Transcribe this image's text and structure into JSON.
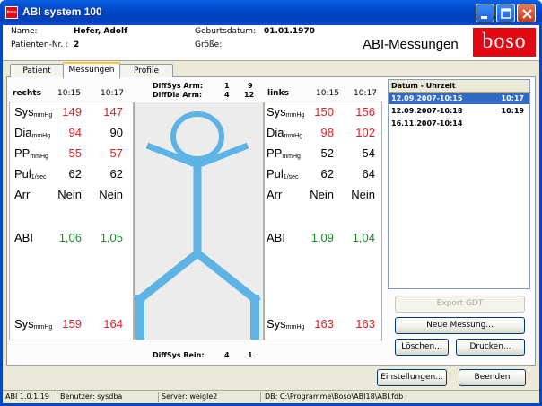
{
  "window": {
    "title": "ABI system 100",
    "app_icon": "boso-app-icon"
  },
  "header": {
    "name_label": "Name:",
    "name_value": "Hofer, Adolf",
    "patient_nr_label": "Patienten-Nr. :",
    "patient_nr_value": "2",
    "birth_label": "Geburtsdatum:",
    "birth_value": "01.01.1970",
    "size_label": "Größe:",
    "size_value": "",
    "section_title": "ABI-Messungen",
    "logo_text": "boso"
  },
  "tabs": [
    {
      "label": "Patient",
      "active": false
    },
    {
      "label": "Messungen",
      "active": true
    },
    {
      "label": "Profile",
      "active": false
    }
  ],
  "diff": {
    "sys_arm_label": "DiffSys Arm:",
    "sys_arm_a": "1",
    "sys_arm_b": "9",
    "dia_arm_label": "DiffDia Arm:",
    "dia_arm_a": "4",
    "dia_arm_b": "12",
    "sys_bein_label": "DiffSys Bein:",
    "sys_bein_a": "4",
    "sys_bein_b": "1"
  },
  "left": {
    "side": "rechts",
    "time1": "10:15",
    "time2": "10:17",
    "sys": [
      "149",
      "147"
    ],
    "dia": [
      "94",
      "90"
    ],
    "pp": [
      "55",
      "57"
    ],
    "pul": [
      "62",
      "62"
    ],
    "arr": [
      "Nein",
      "Nein"
    ],
    "abi": [
      "1,06",
      "1,05"
    ],
    "sys_leg": [
      "159",
      "164"
    ]
  },
  "right": {
    "side": "links",
    "time1": "10:15",
    "time2": "10:17",
    "sys": [
      "150",
      "156"
    ],
    "dia": [
      "98",
      "102"
    ],
    "pp": [
      "52",
      "54"
    ],
    "pul": [
      "62",
      "64"
    ],
    "arr": [
      "Nein",
      "Nein"
    ],
    "abi": [
      "1,09",
      "1,04"
    ],
    "sys_leg": [
      "163",
      "163"
    ]
  },
  "row_labels": {
    "sys": "Sys",
    "sys_unit": "mmHg",
    "dia": "Dia",
    "dia_unit": "mmHg",
    "pp": "PP",
    "pp_unit": "mmHg",
    "pul": "Pul",
    "pul_unit": "1/sec",
    "arr": "Arr",
    "abi": "ABI"
  },
  "list": {
    "header": "Datum - Uhrzeit",
    "rows": [
      {
        "date": "12.09.2007-10:15",
        "time": "10:17",
        "selected": true
      },
      {
        "date": "12.09.2007-10:18",
        "time": "10:19",
        "selected": false
      },
      {
        "date": "16.11.2007-10:14",
        "time": "",
        "selected": false
      }
    ]
  },
  "buttons": {
    "export": "Export GDT",
    "new": "Neue Messung...",
    "delete": "Löschen...",
    "print": "Drucken...",
    "settings": "Einstellungen...",
    "exit": "Beenden"
  },
  "statusbar": {
    "version": "ABI 1.0.1.19",
    "user": "Benutzer: sysdba",
    "server": "Server: weigle2",
    "db": "DB: C:\\Programme\\Boso\\ABI18\\ABI.fdb"
  },
  "colors": {
    "red_value": "#e31e24",
    "green_value": "#1c8c2a",
    "figure": "#5cb3e4",
    "selection": "#316ac5",
    "brand": "#e30613"
  }
}
